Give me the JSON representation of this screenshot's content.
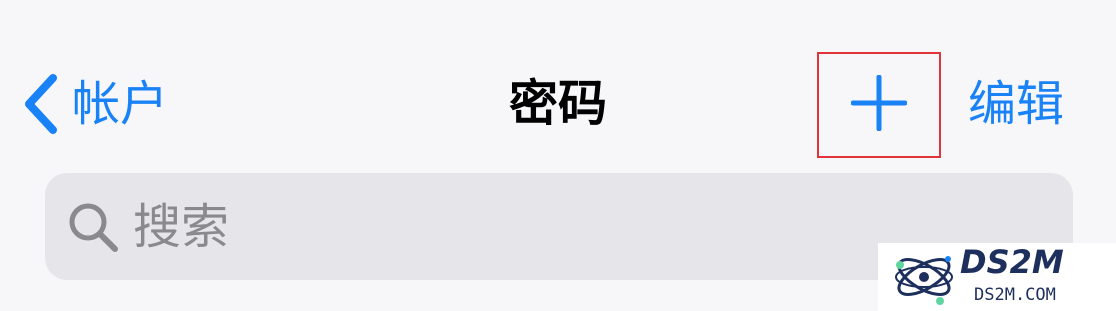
{
  "colors": {
    "accent": "#1a82f7",
    "highlight": "#e0343a",
    "title": "#000000",
    "search_bg": "#e6e6ea",
    "page_bg": "#f7f7fa"
  },
  "nav": {
    "back_label": "帐户",
    "back_icon": "chevron-left-icon",
    "title": "密码",
    "add_icon": "plus-icon",
    "edit_label": "编辑"
  },
  "search": {
    "placeholder": "搜索",
    "value": "",
    "icon": "magnifying-glass-icon"
  },
  "watermark": {
    "brand": "DS2M",
    "domain": "DS2M.COM"
  }
}
